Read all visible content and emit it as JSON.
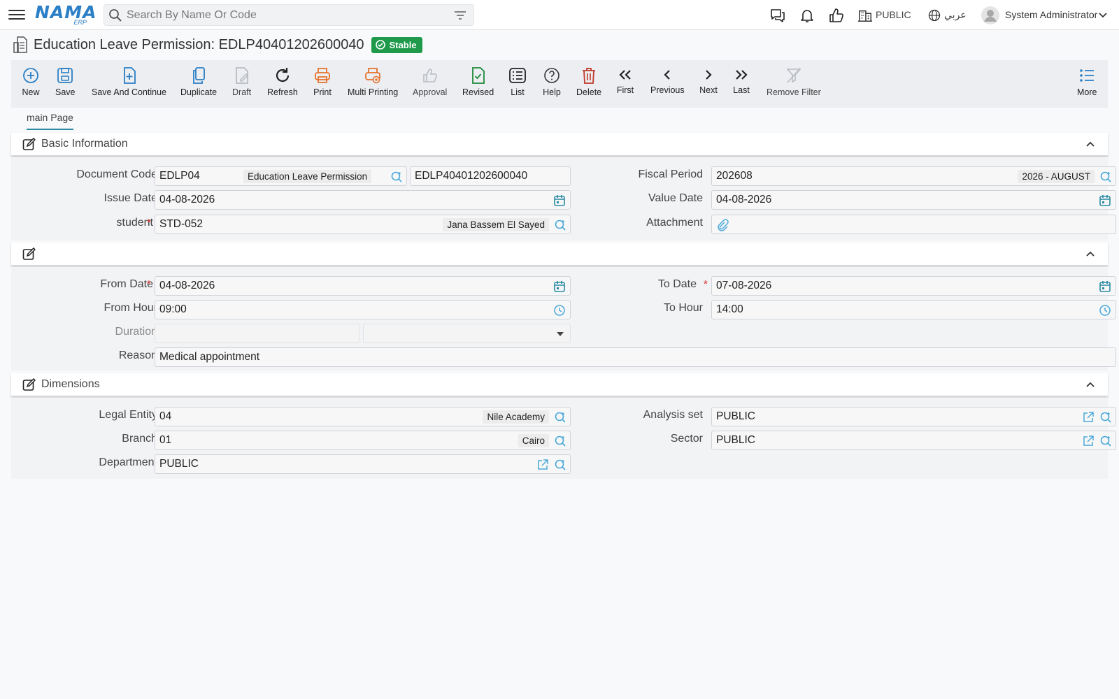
{
  "topbar": {
    "search_placeholder": "Search By Name Or Code",
    "branch_label": "PUBLIC",
    "language_label": "عربي",
    "user_name": "System Administrator"
  },
  "logo": {
    "text": "NAMA",
    "sub": "ERP"
  },
  "page": {
    "title": "Education Leave Permission: EDLP40401202600040",
    "status": "Stable"
  },
  "toolbar": {
    "new": "New",
    "save": "Save",
    "save_continue": "Save And Continue",
    "duplicate": "Duplicate",
    "draft": "Draft",
    "refresh": "Refresh",
    "print": "Print",
    "multi_printing": "Multi Printing",
    "approval": "Approval",
    "revised": "Revised",
    "list": "List",
    "help": "Help",
    "delete": "Delete",
    "first": "First",
    "previous": "Previous",
    "next": "Next",
    "last": "Last",
    "remove_filter": "Remove Filter",
    "more": "More"
  },
  "tabs": {
    "main": "main Page"
  },
  "basic": {
    "title": "Basic Information",
    "document_code_label": "Document Code",
    "document_code": "EDLP04",
    "document_type": "Education Leave Permission",
    "document_number": "EDLP40401202600040",
    "fiscal_period_label": "Fiscal Period",
    "fiscal_period": "202608",
    "fiscal_period_desc": "2026 - AUGUST",
    "issue_date_label": "Issue Date",
    "issue_date": "04-08-2026",
    "value_date_label": "Value Date",
    "value_date": "04-08-2026",
    "student_label": "student",
    "student_code": "STD-052",
    "student_name": "Jana Bassem El Sayed",
    "attachment_label": "Attachment",
    "required_mark": "*"
  },
  "details": {
    "from_date_label": "From Date",
    "from_date": "04-08-2026",
    "to_date_label": "To Date",
    "to_date": "07-08-2026",
    "from_hour_label": "From Hour",
    "from_hour": "09:00",
    "to_hour_label": "To Hour",
    "to_hour": "14:00",
    "duration_label": "Duration",
    "reason_label": "Reason",
    "reason": "Medical appointment"
  },
  "dimensions": {
    "title": "Dimensions",
    "legal_entity_label": "Legal Entity",
    "legal_entity": "04",
    "legal_entity_name": "Nile Academy",
    "analysis_set_label": "Analysis set",
    "analysis_set": "PUBLIC",
    "branch_label": "Branch",
    "branch": "01",
    "branch_name": "Cairo",
    "sector_label": "Sector",
    "sector": "PUBLIC",
    "department_label": "Department",
    "department": "PUBLIC"
  },
  "colors": {
    "brand": "#2a7fc6",
    "teal": "#2a8aa3",
    "stable": "#1e9a4a",
    "print": "#e8702a",
    "delete": "#c0392b",
    "revised": "#1e8a3a"
  }
}
